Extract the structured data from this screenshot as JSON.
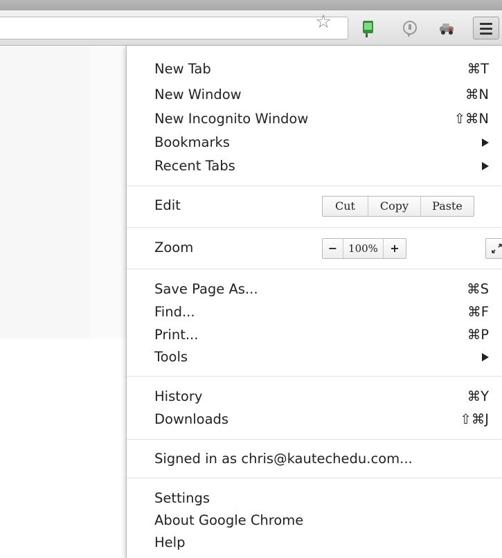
{
  "menu": {
    "group1": [
      {
        "label": "New Tab",
        "shortcut": "⌘T"
      },
      {
        "label": "New Window",
        "shortcut": "⌘N"
      },
      {
        "label": "New Incognito Window",
        "shortcut": "⇧⌘N"
      },
      {
        "label": "Bookmarks",
        "submenu": true
      },
      {
        "label": "Recent Tabs",
        "submenu": true
      }
    ],
    "edit": {
      "label": "Edit",
      "cut": "Cut",
      "copy": "Copy",
      "paste": "Paste"
    },
    "zoom": {
      "label": "Zoom",
      "minus": "−",
      "value": "100%",
      "plus": "+"
    },
    "group2": [
      {
        "label": "Save Page As...",
        "shortcut": "⌘S"
      },
      {
        "label": "Find...",
        "shortcut": "⌘F"
      },
      {
        "label": "Print...",
        "shortcut": "⌘P"
      },
      {
        "label": "Tools",
        "submenu": true
      }
    ],
    "group3": [
      {
        "label": "History",
        "shortcut": "⌘Y"
      },
      {
        "label": "Downloads",
        "shortcut": "⇧⌘J"
      }
    ],
    "signed_in": "Signed in as chris@kautechedu.com...",
    "group4": [
      {
        "label": "Settings"
      },
      {
        "label": "About Google Chrome"
      },
      {
        "label": "Help"
      }
    ]
  },
  "colors": {
    "accent": "#4a7ed6",
    "separator": "#e2e2e2"
  }
}
